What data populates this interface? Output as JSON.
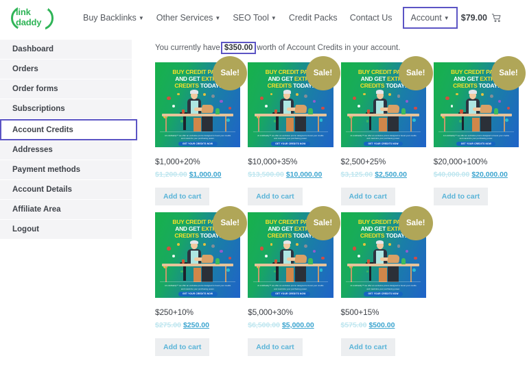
{
  "header": {
    "logo_line1": "link",
    "logo_line2": "daddy",
    "nav": [
      {
        "label": "Buy Backlinks",
        "has_caret": true,
        "boxed": false
      },
      {
        "label": "Other Services",
        "has_caret": true,
        "boxed": false
      },
      {
        "label": "SEO Tool",
        "has_caret": true,
        "boxed": false
      },
      {
        "label": "Credit Packs",
        "has_caret": false,
        "boxed": false
      },
      {
        "label": "Contact Us",
        "has_caret": false,
        "boxed": false
      },
      {
        "label": "Account",
        "has_caret": true,
        "boxed": true
      }
    ],
    "cart_total": "$79.00",
    "caret_glyph": "▼"
  },
  "sidebar": {
    "items": [
      {
        "label": "Dashboard",
        "active": false
      },
      {
        "label": "Orders",
        "active": false
      },
      {
        "label": "Order forms",
        "active": false
      },
      {
        "label": "Subscriptions",
        "active": false
      },
      {
        "label": "Account Credits",
        "active": true
      },
      {
        "label": "Addresses",
        "active": false
      },
      {
        "label": "Payment methods",
        "active": false
      },
      {
        "label": "Account Details",
        "active": false
      },
      {
        "label": "Affiliate Area",
        "active": false
      },
      {
        "label": "Logout",
        "active": false
      }
    ]
  },
  "main": {
    "notice_before": "You currently have",
    "notice_amount": "$350.00",
    "notice_after": "worth of Account Credits in your account.",
    "promo": {
      "line1_a": "BUY CREDIT PACK",
      "line2_a": "AND GET ",
      "line2_b": "EXTRA",
      "line3_a": "CREDITS ",
      "line3_b": "TODAY!",
      "caption": "At LinkDaddy™ we offer an exclusive promo designed to boost your credits and maximize your purchasing power.",
      "cta": "GET YOUR CREDITS NOW"
    },
    "sale_badge": "Sale!",
    "add_to_cart_label": "Add to cart",
    "products": [
      {
        "title": "$1,000+20%",
        "old_price": "$1,200.00",
        "new_price": "$1,000.00"
      },
      {
        "title": "$10,000+35%",
        "old_price": "$13,500.00",
        "new_price": "$10,000.00"
      },
      {
        "title": "$2,500+25%",
        "old_price": "$3,125.00",
        "new_price": "$2,500.00"
      },
      {
        "title": "$20,000+100%",
        "old_price": "$40,000.00",
        "new_price": "$20,000.00"
      },
      {
        "title": "$250+10%",
        "old_price": "$275.00",
        "new_price": "$250.00"
      },
      {
        "title": "$5,000+30%",
        "old_price": "$6,500.00",
        "new_price": "$5,000.00"
      },
      {
        "title": "$500+15%",
        "old_price": "$575.00",
        "new_price": "$500.00"
      }
    ]
  },
  "colors": {
    "accent_purple": "#5b54c4",
    "brand_green": "#2fb457",
    "price_blue": "#3ba4cf",
    "sale_badge": "#b0a658"
  }
}
